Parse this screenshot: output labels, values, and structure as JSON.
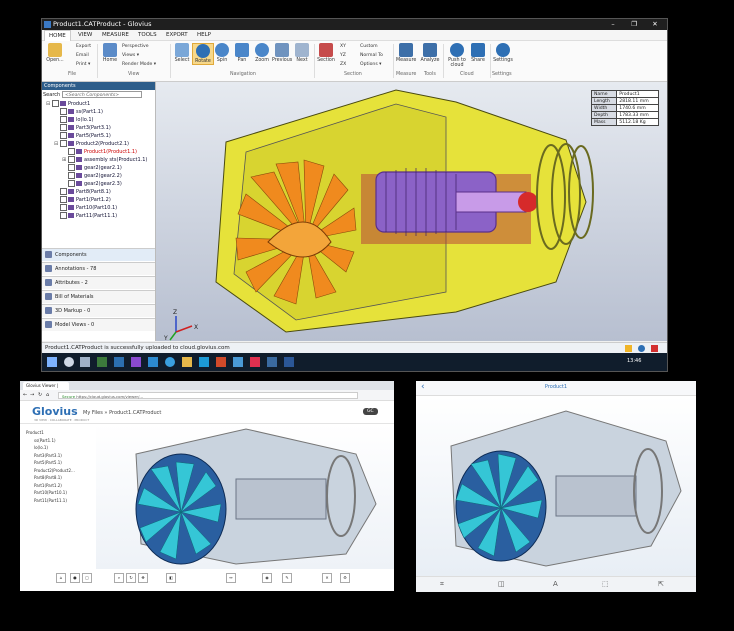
{
  "main_window": {
    "title": "Product1.CATProduct - Glovius",
    "window_controls": [
      "–",
      "❐",
      "✕"
    ],
    "menu": [
      {
        "label": "HOME",
        "active": true
      },
      {
        "label": "VIEW"
      },
      {
        "label": "MEASURE"
      },
      {
        "label": "TOOLS"
      },
      {
        "label": "EXPORT"
      },
      {
        "label": "HELP"
      }
    ],
    "ribbon": {
      "open": "Open...",
      "export": "Export",
      "email": "Email",
      "print": "Print ▾",
      "home": "Home",
      "perspective": "Perspective",
      "views": "Views ▾",
      "render_mode": "Render Mode ▾",
      "select": "Select",
      "rotate": "Rotate",
      "spin": "Spin",
      "pan": "Pan",
      "zoom": "Zoom",
      "previous": "Previous",
      "next": "Next",
      "section": "Section",
      "xy": "XY",
      "yz": "YZ",
      "zx": "ZX",
      "custom": "Custom",
      "normal_to": "Normal To",
      "options": "Options ▾",
      "measure": "Measure",
      "analyze": "Analyze",
      "push_to_cloud": "Push to cloud",
      "share": "Share",
      "settings": "Settings",
      "groups": [
        "File",
        "View",
        "Navigation",
        "Section",
        "Measure",
        "Tools",
        "Cloud",
        "Settings"
      ]
    },
    "components_panel": {
      "header": "Components",
      "search_label": "Search",
      "search_placeholder": "<Search Components>",
      "tree": [
        {
          "label": "Product1",
          "indent": 0,
          "expand": "⊟"
        },
        {
          "label": "ss(Part1.1)",
          "indent": 1
        },
        {
          "label": "lo(lo.1)",
          "indent": 1
        },
        {
          "label": "Part3(Part3.1)",
          "indent": 1
        },
        {
          "label": "Part5(Part5.1)",
          "indent": 1
        },
        {
          "label": "Product2(Product2.1)",
          "indent": 1,
          "expand": "⊟"
        },
        {
          "label": "Product1(Product1.1)",
          "indent": 2,
          "selected": true
        },
        {
          "label": "assembly sts(Product1.1)",
          "indent": 2,
          "expand": "⊞"
        },
        {
          "label": "gear2(gear2.1)",
          "indent": 2
        },
        {
          "label": "gear2(gear2.2)",
          "indent": 2
        },
        {
          "label": "gear2(gear2.3)",
          "indent": 2
        },
        {
          "label": "Part8(Part8.1)",
          "indent": 1
        },
        {
          "label": "Part1(Part1.2)",
          "indent": 1
        },
        {
          "label": "Part10(Part10.1)",
          "indent": 1
        },
        {
          "label": "Part11(Part11.1)",
          "indent": 1
        }
      ],
      "buttons": [
        {
          "label": "Components",
          "active": true
        },
        {
          "label": "Annotations - 78"
        },
        {
          "label": "Attributes - 2"
        },
        {
          "label": "Bill of Materials"
        },
        {
          "label": "3D Markup - 0"
        },
        {
          "label": "Model Views - 0"
        }
      ]
    },
    "properties": [
      {
        "key": "Name",
        "value": "Product1"
      },
      {
        "key": "Length",
        "value": "2818.11 mm"
      },
      {
        "key": "Width",
        "value": "1740.6 mm"
      },
      {
        "key": "Depth",
        "value": "1783.33 mm"
      },
      {
        "key": "Mass",
        "value": "5112.18 Kg"
      }
    ],
    "axes": {
      "x": "X",
      "y": "Y",
      "z": "Z"
    },
    "status": "Product1.CATProduct  is successfully uploaded to cloud.glovius.com",
    "taskbar_time": "13:46"
  },
  "browser": {
    "tab_title": "Glovius Viewer | Glovius",
    "address": "https://cloud.glovius.com/viewer/...",
    "secure_label": "Secure",
    "logo": "Glovius",
    "logo_sub": "3D VIEW · COLLABORATE · PRODUCT",
    "breadcrumb": "My Files  »  Product1.CATProduct",
    "user_label": "GC",
    "tree": [
      "Product1",
      "ss(Part1.1)",
      "lo(lo.1)",
      "Part3(Part3.1)",
      "Part5(Part5.1)",
      "Product2(Product2...",
      "Part8(Part8.1)",
      "Part1(Part1.2)",
      "Part10(Part10.1)",
      "Part11(Part11.1)"
    ]
  },
  "tablet": {
    "title": "Product1",
    "back": "‹"
  },
  "colors": {
    "accent": "#2e6fb4",
    "selected_text": "#cc0000",
    "titlebar": "#1f1f1f",
    "panel_header": "#2d5d8a",
    "engine_yellow": "#e6e23a",
    "engine_orange": "#f08a1e",
    "engine_purple": "#7a4fb0",
    "engine_cyan": "#35c6d6"
  }
}
